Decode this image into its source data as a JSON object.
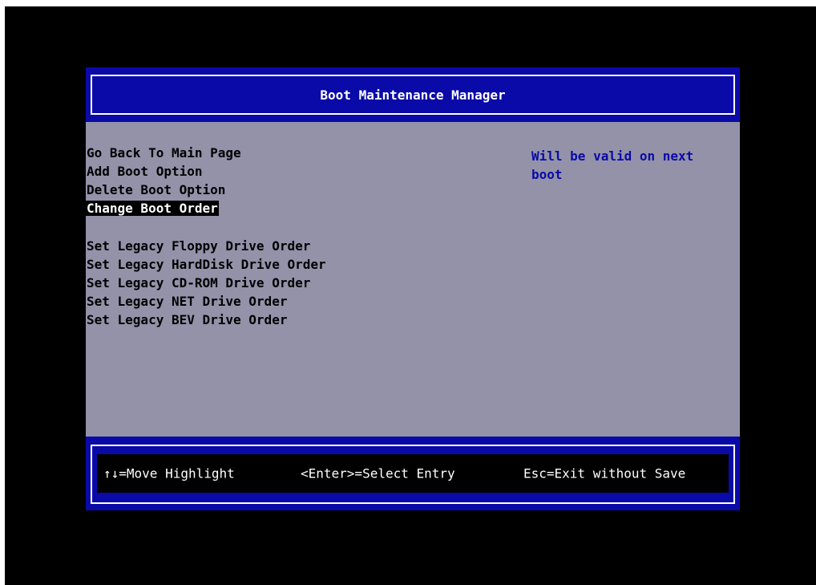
{
  "title": "Boot Maintenance Manager",
  "menu": {
    "items": [
      {
        "label": "Go Back To Main Page"
      },
      {
        "label": "Add Boot Option"
      },
      {
        "label": "Delete Boot Option"
      },
      {
        "label": "Change Boot Order"
      }
    ],
    "legacy_items": [
      {
        "label": "Set Legacy Floppy Drive Order"
      },
      {
        "label": "Set Legacy HardDisk Drive Order"
      },
      {
        "label": "Set Legacy CD-ROM Drive Order"
      },
      {
        "label": "Set Legacy NET Drive Order"
      },
      {
        "label": "Set Legacy BEV Drive Order"
      }
    ],
    "selected_label": "Change Boot Order"
  },
  "help": {
    "line1": "Will be valid on next",
    "line2": "boot"
  },
  "footer": {
    "move": "↑↓=Move Highlight",
    "select": "<Enter>=Select Entry",
    "exit": "Esc=Exit without Save"
  },
  "colors": {
    "screen_bg": "#000000",
    "bar_blue": "#0a0aa8",
    "panel_gray": "#9392a9",
    "text_black": "#000000",
    "text_white": "#ffffff",
    "help_blue": "#0a0aa8"
  }
}
